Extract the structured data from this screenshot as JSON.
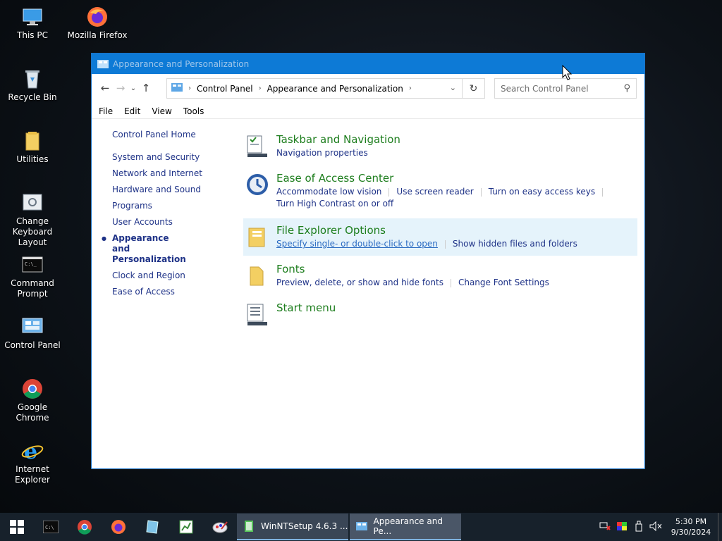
{
  "desktop": {
    "icons": [
      {
        "label": "This PC"
      },
      {
        "label": "Mozilla Firefox"
      },
      {
        "label": "Recycle Bin"
      },
      {
        "label": "Utilities"
      },
      {
        "label": "Change Keyboard Layout"
      },
      {
        "label": "Command Prompt"
      },
      {
        "label": "Control Panel"
      },
      {
        "label": "Google Chrome"
      },
      {
        "label": "Internet Explorer"
      }
    ]
  },
  "window": {
    "title": "Appearance and Personalization",
    "address": {
      "crumbs": [
        "Control Panel",
        "Appearance and Personalization"
      ]
    },
    "search": {
      "placeholder": "Search Control Panel"
    },
    "menu": [
      "File",
      "Edit",
      "View",
      "Tools"
    ],
    "leftnav": {
      "home": "Control Panel Home",
      "items": [
        "System and Security",
        "Network and Internet",
        "Hardware and Sound",
        "Programs",
        "User Accounts",
        "Appearance and Personalization",
        "Clock and Region",
        "Ease of Access"
      ],
      "active_index": 5
    },
    "categories": [
      {
        "title": "Taskbar and Navigation",
        "links": [
          "Navigation properties"
        ]
      },
      {
        "title": "Ease of Access Center",
        "links": [
          "Accommodate low vision",
          "Use screen reader",
          "Turn on easy access keys",
          "Turn High Contrast on or off"
        ]
      },
      {
        "title": "File Explorer Options",
        "links": [
          "Specify single- or double-click to open",
          "Show hidden files and folders"
        ]
      },
      {
        "title": "Fonts",
        "links": [
          "Preview, delete, or show and hide fonts",
          "Change Font Settings"
        ]
      },
      {
        "title": "Start menu",
        "links": []
      }
    ]
  },
  "taskbar": {
    "tasks": [
      {
        "label": "WinNTSetup 4.6.3  ..."
      },
      {
        "label": "Appearance and Pe..."
      }
    ],
    "clock": {
      "time": "5:30 PM",
      "date": "9/30/2024"
    }
  },
  "colors": {
    "accent": "#0d7ad6",
    "category_title": "#1e7e1e",
    "link": "#1e3287",
    "highlight": "#e5f3fb",
    "taskbar": "#17212b"
  }
}
